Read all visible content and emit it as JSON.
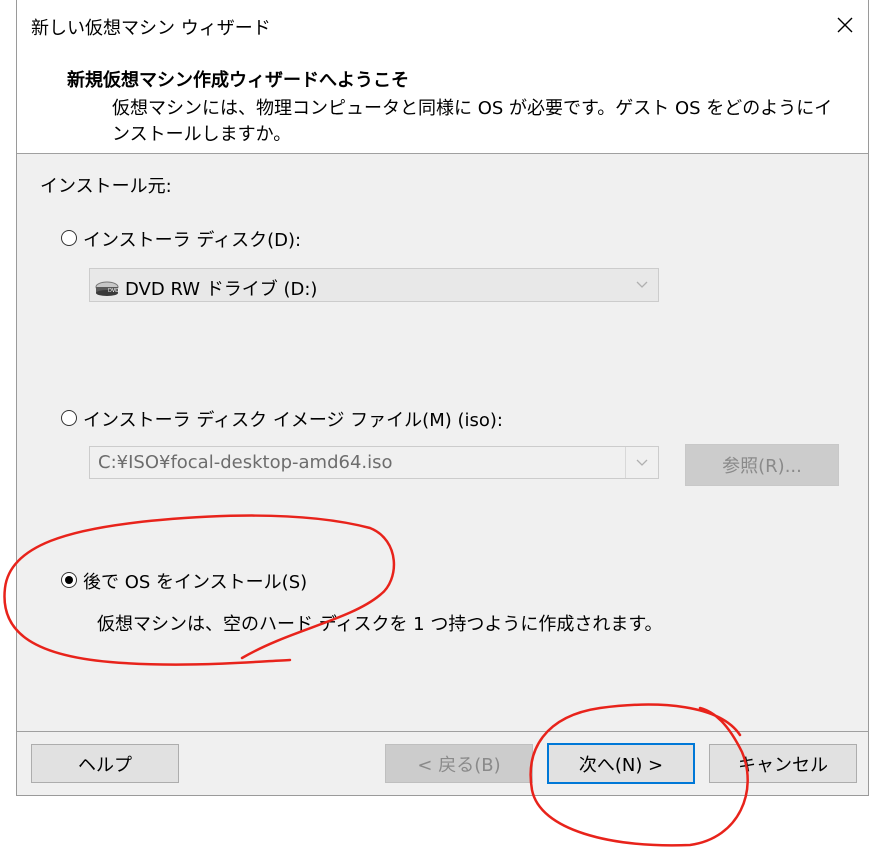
{
  "window": {
    "title": "新しい仮想マシン ウィザード"
  },
  "header": {
    "heading": "新規仮想マシン作成ウィザードへようこそ",
    "description": "仮想マシンには、物理コンピュータと同様に OS が必要です。ゲスト OS をどのようにインストールしますか。"
  },
  "install_source": {
    "label": "インストール元:",
    "disc": {
      "label": "インストーラ ディスク(D):",
      "selected": false,
      "drive_value": "DVD RW ドライブ (D:)"
    },
    "iso": {
      "label": "インストーラ ディスク イメージ ファイル(M) (iso):",
      "selected": false,
      "path_value": "C:¥ISO¥focal-desktop-amd64.iso",
      "browse_label": "参照(R)..."
    },
    "later": {
      "label": "後で OS をインストール(S)",
      "selected": true,
      "note": "仮想マシンは、空のハード ディスクを 1 つ持つように作成されます。"
    }
  },
  "footer": {
    "help_label": "ヘルプ",
    "back_label": "< 戻る(B)",
    "next_label": "次へ(N) >",
    "cancel_label": "キャンセル"
  },
  "colors": {
    "annotation": "#e8231b",
    "focus_border": "#0078d7",
    "disabled_text": "#8a8a8a"
  },
  "icons": {
    "close": "close-icon",
    "dvd": "dvd-drive-icon",
    "dropdown": "chevron-down-icon"
  }
}
